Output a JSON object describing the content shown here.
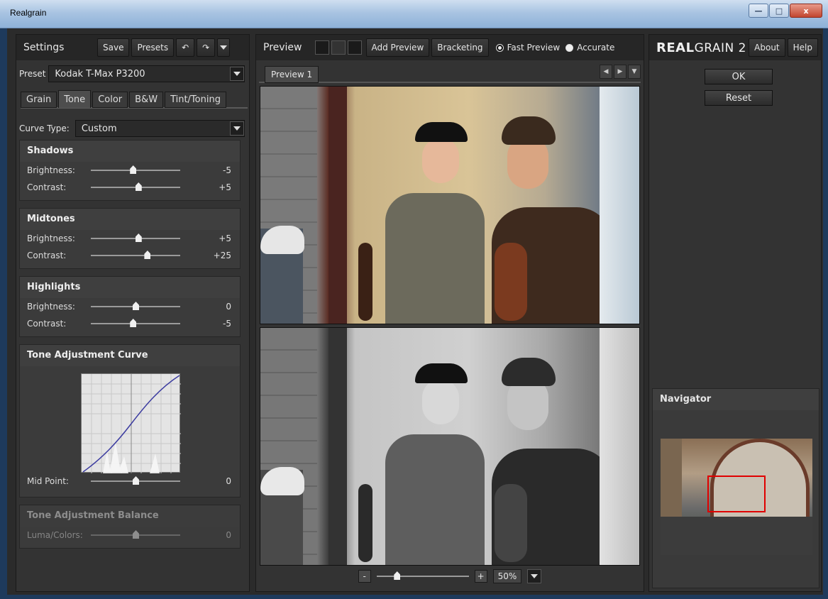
{
  "window": {
    "title": "Realgrain",
    "min": "—",
    "max": "□",
    "close": "x"
  },
  "left": {
    "title": "Settings",
    "buttons": {
      "save": "Save",
      "presets": "Presets",
      "undo": "↶",
      "redo": "↷"
    },
    "preset_label": "Preset",
    "preset_value": "Kodak T-Max P3200",
    "tabs": [
      "Grain",
      "Tone",
      "Color",
      "B&W",
      "Tint/Toning"
    ],
    "active_tab": "Tone",
    "curve_type_label": "Curve Type:",
    "curve_type_value": "Custom",
    "groups": {
      "shadows": {
        "title": "Shadows",
        "brightness_label": "Brightness:",
        "brightness": "-5",
        "brightness_pos": 0.47,
        "contrast_label": "Contrast:",
        "contrast": "+5",
        "contrast_pos": 0.53
      },
      "midtones": {
        "title": "Midtones",
        "brightness_label": "Brightness:",
        "brightness": "+5",
        "brightness_pos": 0.53,
        "contrast_label": "Contrast:",
        "contrast": "+25",
        "contrast_pos": 0.63
      },
      "highlights": {
        "title": "Highlights",
        "brightness_label": "Brightness:",
        "brightness": "0",
        "brightness_pos": 0.5,
        "contrast_label": "Contrast:",
        "contrast": "-5",
        "contrast_pos": 0.47
      }
    },
    "curve": {
      "title": "Tone Adjustment Curve",
      "mid_label": "Mid Point:",
      "mid_value": "0",
      "mid_pos": 0.5
    },
    "balance": {
      "title": "Tone Adjustment Balance",
      "luma_label": "Luma/Colors:",
      "luma_value": "0",
      "luma_pos": 0.5
    }
  },
  "center": {
    "title": "Preview",
    "add_preview": "Add Preview",
    "bracketing": "Bracketing",
    "fast_preview": "Fast Preview",
    "accurate": "Accurate",
    "tab": "Preview 1",
    "zoom_minus": "-",
    "zoom_plus": "+",
    "zoom_value": "50%",
    "zoom_pos": 0.22
  },
  "right": {
    "logo_big": "REAL",
    "logo_rest": "GRAIN",
    "logo_ver": "2",
    "about": "About",
    "help": "Help",
    "ok": "OK",
    "reset": "Reset",
    "navigator": "Navigator"
  }
}
